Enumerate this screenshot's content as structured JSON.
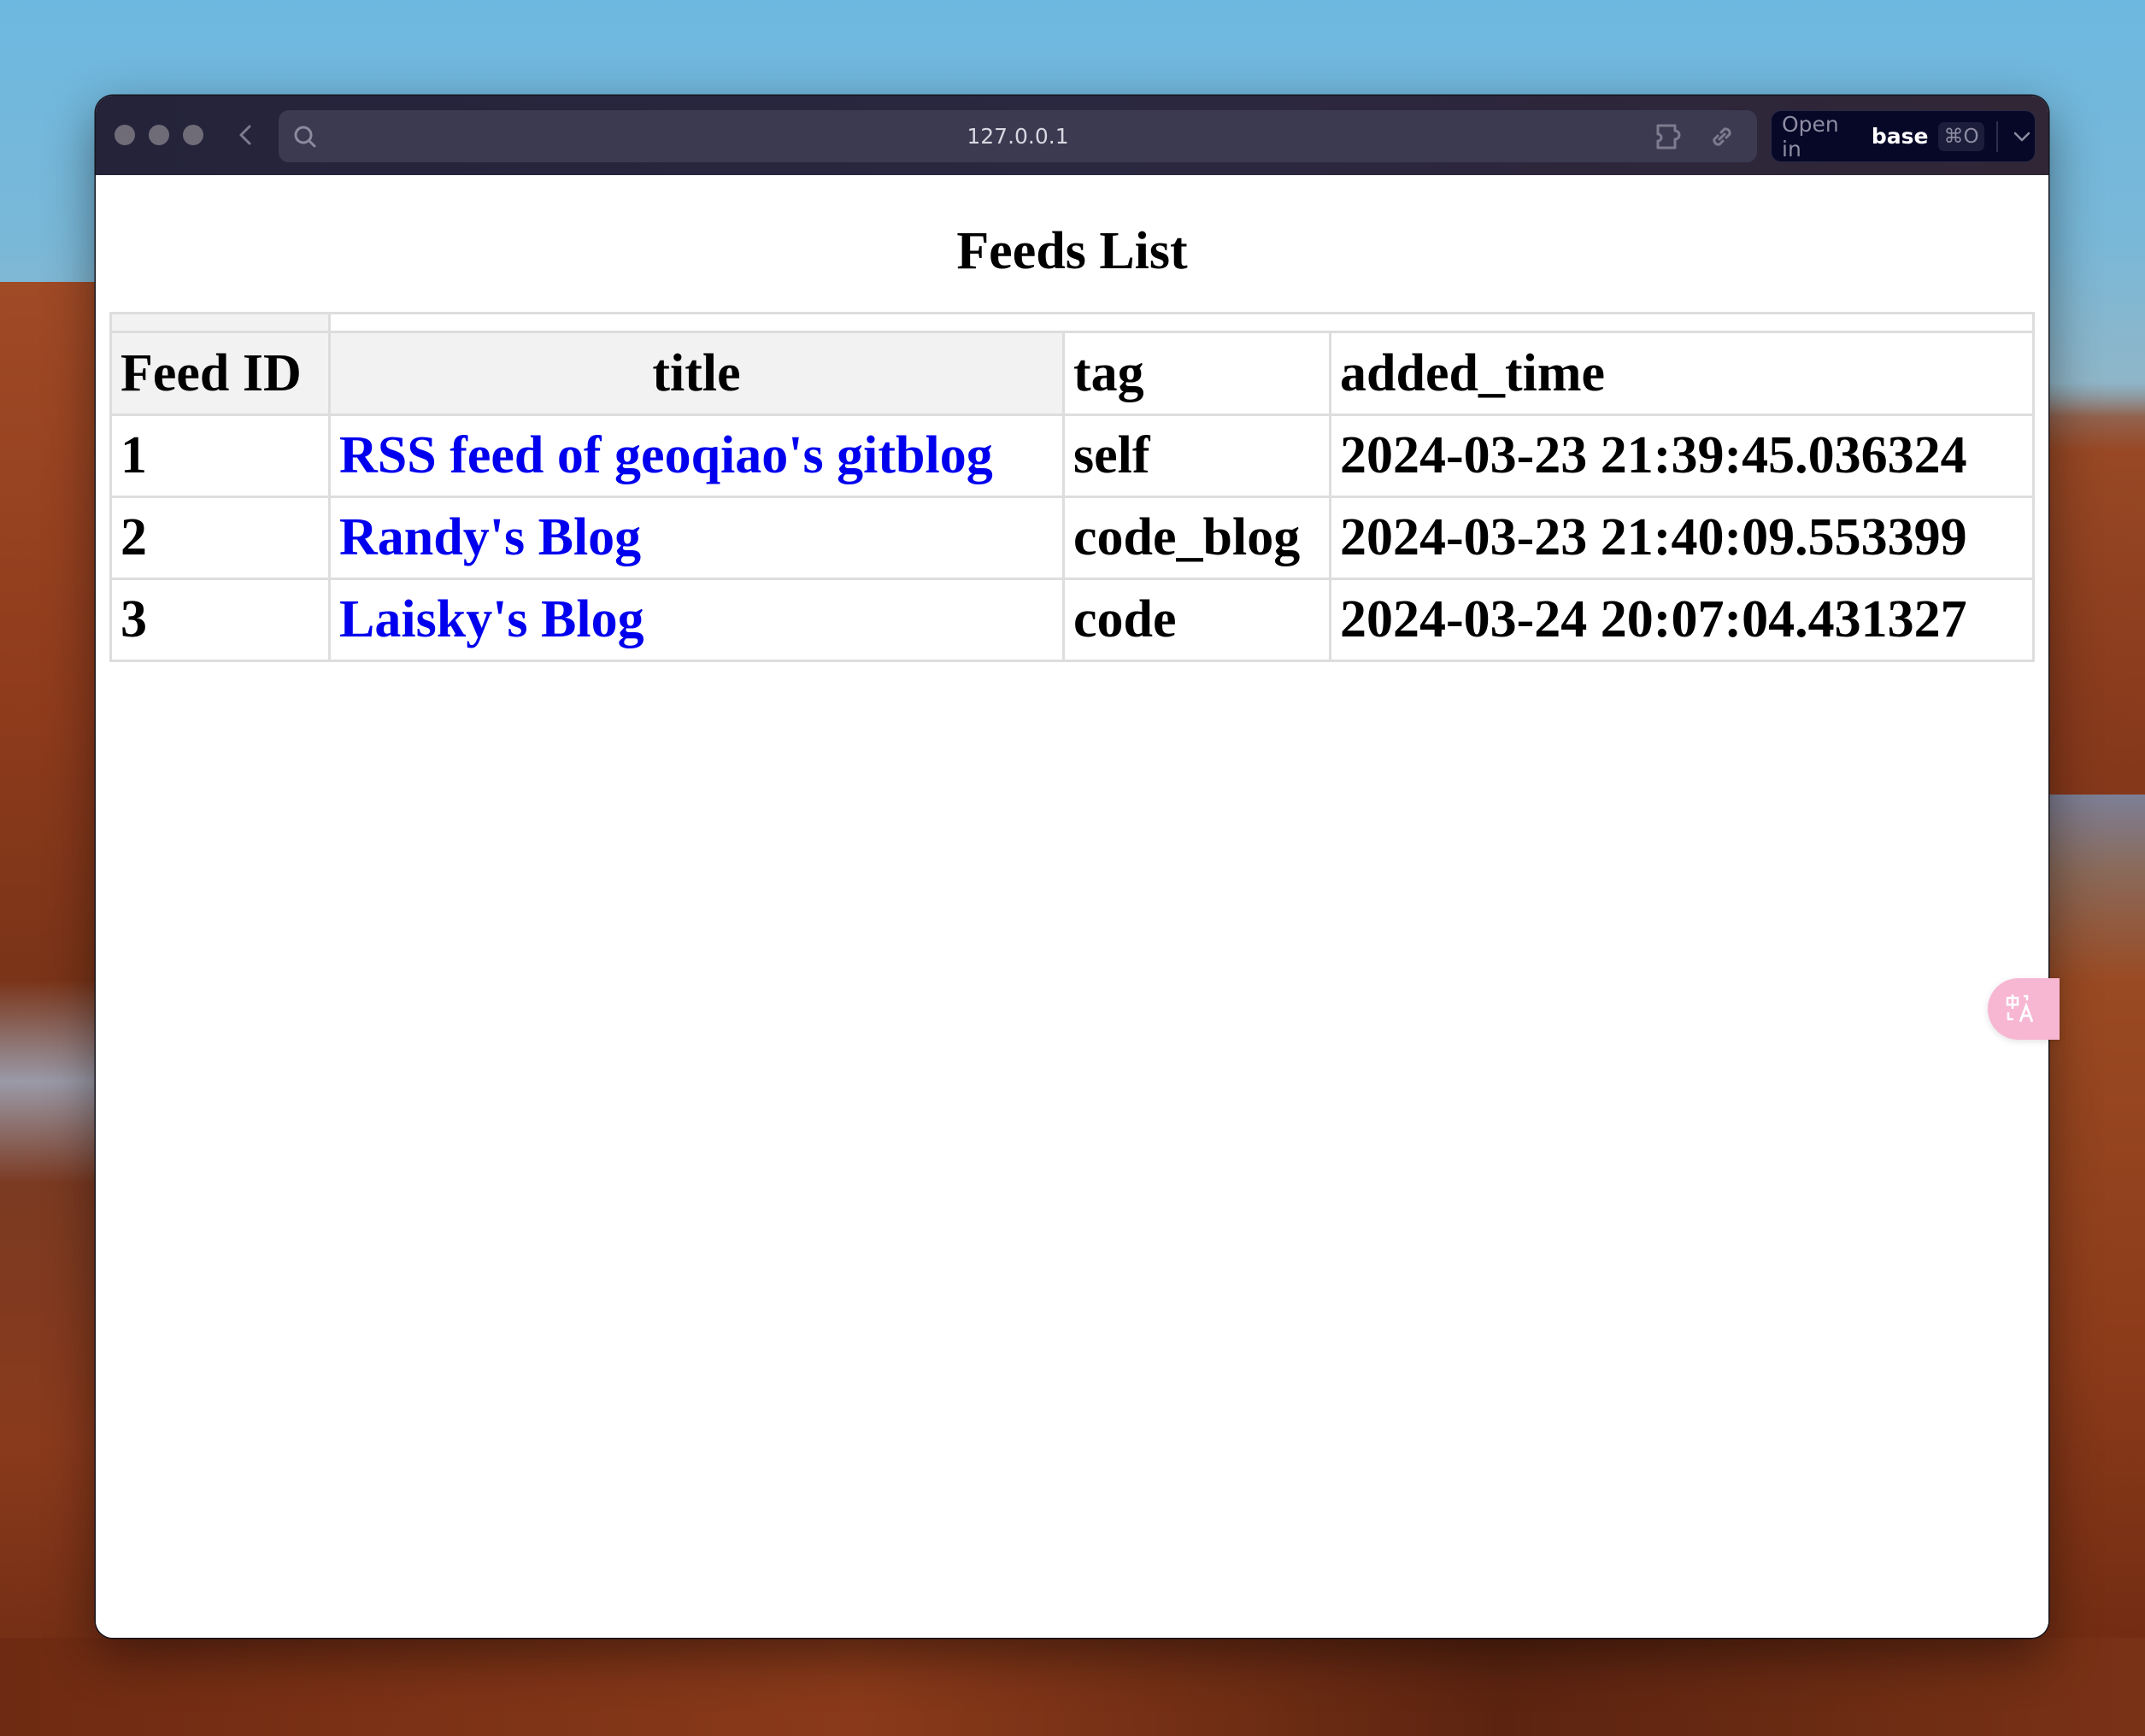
{
  "browser": {
    "url": "127.0.0.1",
    "open_in": {
      "label": "Open in",
      "app": "base",
      "shortcut": "⌘O"
    },
    "icons": {
      "window_controls": [
        "close-dot",
        "minimize-dot",
        "zoom-dot"
      ],
      "back": "chevron-left-icon",
      "search": "search-icon",
      "extension": "puzzle-icon",
      "link": "link-icon",
      "dropdown": "chevron-down-icon"
    }
  },
  "page": {
    "title": "Feeds List",
    "table": {
      "columns": [
        "Feed ID",
        "title",
        "tag",
        "added_time"
      ],
      "rows": [
        {
          "id": "1",
          "title": "RSS feed of geoqiao's gitblog",
          "tag": "self",
          "added_time": "2024-03-23 21:39:45.036324"
        },
        {
          "id": "2",
          "title": "Randy's Blog",
          "tag": "code_blog",
          "added_time": "2024-03-23 21:40:09.553399"
        },
        {
          "id": "3",
          "title": "Laisky's Blog",
          "tag": "code",
          "added_time": "2024-03-24 20:07:04.431327"
        }
      ]
    }
  },
  "overlay": {
    "translate_button_icon": "translate-icon"
  },
  "colors": {
    "link": "#0000ee",
    "header_shade": "#f2f2f2",
    "border": "#dddddd",
    "titlebar": "#24233a",
    "urlbar": "#3c3a50",
    "open_in_bg": "#070828",
    "translate_button": "#f7b6d2"
  }
}
